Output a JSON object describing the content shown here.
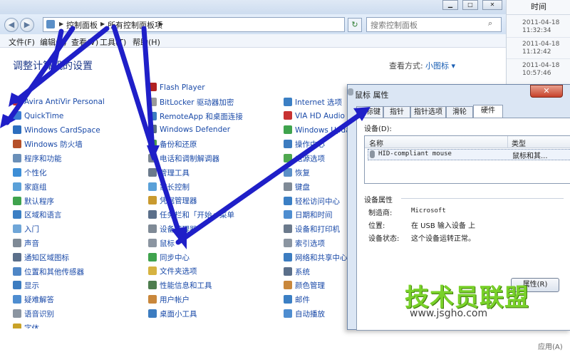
{
  "breadcrumb": {
    "item1": "控制面板",
    "item2": "所有控制面板项"
  },
  "search": {
    "placeholder": "搜索控制面板"
  },
  "menu": {
    "file": "文件(F)",
    "edit": "编辑(E)",
    "view": "查看(V)",
    "tools": "工具(T)",
    "help": "帮助(H)"
  },
  "page": {
    "title": "调整计算机的设置",
    "view_label": "查看方式:",
    "view_value": "小图标 ▾"
  },
  "col1": [
    {
      "label": "Avira AntiVir Personal",
      "color": "#c83232"
    },
    {
      "label": "QuickTime",
      "color": "#3a7bd5"
    },
    {
      "label": "Windows CardSpace",
      "color": "#2c6ebe"
    },
    {
      "label": "Windows 防火墙",
      "color": "#b5502a"
    },
    {
      "label": "程序和功能",
      "color": "#6a8fb8"
    },
    {
      "label": "个性化",
      "color": "#3d8ed6"
    },
    {
      "label": "家庭组",
      "color": "#5aa0d8"
    },
    {
      "label": "默认程序",
      "color": "#3fa34d"
    },
    {
      "label": "区域和语言",
      "color": "#3b7fc4"
    },
    {
      "label": "入门",
      "color": "#6fa6d8"
    },
    {
      "label": "声音",
      "color": "#7f8a96"
    },
    {
      "label": "通知区域图标",
      "color": "#5b6f8a"
    },
    {
      "label": "位置和其他传感器",
      "color": "#4f86c6"
    },
    {
      "label": "显示",
      "color": "#3c7cc0"
    },
    {
      "label": "疑难解答",
      "color": "#4e8dd0"
    },
    {
      "label": "语音识别",
      "color": "#8b95a1"
    },
    {
      "label": "字体",
      "color": "#c9a227"
    }
  ],
  "col2": [
    {
      "label": "Flash Player",
      "color": "#b22222"
    },
    {
      "label": "BitLocker 驱动器加密",
      "color": "#9a9a9a"
    },
    {
      "label": "RemoteApp 和桌面连接",
      "color": "#3c7cc0"
    },
    {
      "label": "Windows Defender",
      "color": "#5a6e82"
    },
    {
      "label": "备份和还原",
      "color": "#4d9a4d"
    },
    {
      "label": "电话和调制解调器",
      "color": "#7a8592"
    },
    {
      "label": "管理工具",
      "color": "#6b7a8c"
    },
    {
      "label": "家长控制",
      "color": "#5aa0d8"
    },
    {
      "label": "凭据管理器",
      "color": "#c99a2e"
    },
    {
      "label": "任务栏和「开始」菜单",
      "color": "#5b6f8a"
    },
    {
      "label": "设备管理器",
      "color": "#7f8a96"
    },
    {
      "label": "鼠标",
      "color": "#8b95a1"
    },
    {
      "label": "同步中心",
      "color": "#3fa34d"
    },
    {
      "label": "文件夹选项",
      "color": "#d6b341"
    },
    {
      "label": "性能信息和工具",
      "color": "#4e7d4e"
    },
    {
      "label": "用户帐户",
      "color": "#c9873b"
    },
    {
      "label": "桌面小工具",
      "color": "#3c7cc0"
    }
  ],
  "col3": [
    {
      "label": "Internet 选项",
      "color": "#3b7fc4"
    },
    {
      "label": "VIA HD Audio De",
      "color": "#c83232"
    },
    {
      "label": "Windows Update",
      "color": "#3fa34d"
    },
    {
      "label": "操作中心",
      "color": "#3c7cc0"
    },
    {
      "label": "电源选项",
      "color": "#4fa84f"
    },
    {
      "label": "恢复",
      "color": "#5b8fc7"
    },
    {
      "label": "键盘",
      "color": "#7f8a96"
    },
    {
      "label": "轻松访问中心",
      "color": "#3b7fc4"
    },
    {
      "label": "日期和时间",
      "color": "#4e8dd0"
    },
    {
      "label": "设备和打印机",
      "color": "#6b7a8c"
    },
    {
      "label": "索引选项",
      "color": "#8b95a1"
    },
    {
      "label": "网络和共享中心",
      "color": "#3c7cc0"
    },
    {
      "label": "系统",
      "color": "#5b6f8a"
    },
    {
      "label": "颜色管理",
      "color": "#c9873b"
    },
    {
      "label": "邮件",
      "color": "#3b7fc4"
    },
    {
      "label": "自动播放",
      "color": "#4e8dd0"
    }
  ],
  "side": {
    "header": "时间",
    "times": [
      {
        "date": "2011-04-18",
        "time": "11:32:34"
      },
      {
        "date": "2011-04-18",
        "time": "11:12:42"
      },
      {
        "date": "2011-04-18",
        "time": "10:57:46"
      }
    ]
  },
  "dialog": {
    "title": "鼠标 属性",
    "tabs": [
      "鼠标键",
      "指针",
      "指针选项",
      "滑轮",
      "硬件"
    ],
    "devices_label": "设备(D):",
    "col_name": "名称",
    "col_type": "类型",
    "device_name": "HID-compliant mouse",
    "device_type": "鼠标和其...",
    "props_title": "设备属性",
    "manufacturer_label": "制造商:",
    "manufacturer": "Microsoft",
    "location_label": "位置:",
    "location": "在 USB 输入设备 上",
    "status_label": "设备状态:",
    "status": "这个设备运转正常。",
    "properties_button": "属性(R)",
    "apply_button": "应用(A)"
  },
  "watermark": {
    "title": "技术员联盟",
    "url": "www.jsgho.com"
  },
  "colors": {
    "arrow": "#1f1fc8",
    "link": "#1a4aa8"
  }
}
